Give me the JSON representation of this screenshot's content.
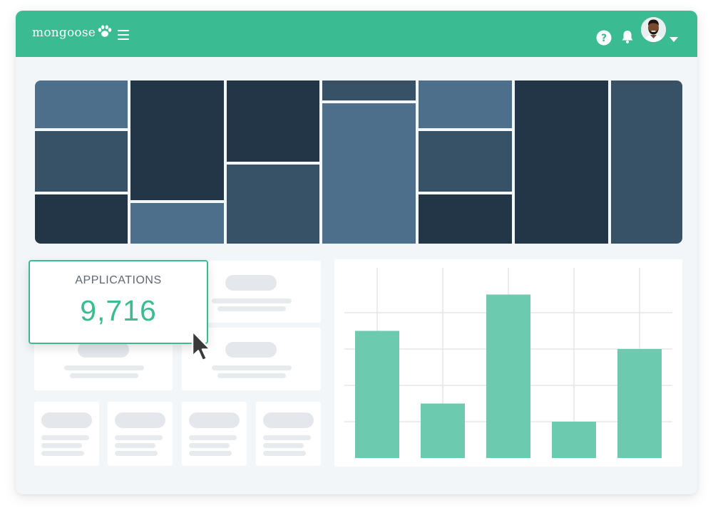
{
  "header": {
    "brand": "mongoose",
    "icons": {
      "logo": "paw-icon",
      "menu": "hamburger-icon",
      "help": "help-circle-icon",
      "notifications": "bell-icon",
      "account_menu": "caret-down-icon"
    },
    "color": "#3bbb91"
  },
  "treemap": {
    "palette": {
      "light": "#4e6f8b",
      "mid": "#375167",
      "dark": "#233648"
    }
  },
  "stat": {
    "label": "APPLICATIONS",
    "value": "9,716"
  },
  "chart_data": {
    "type": "bar",
    "values": [
      70,
      30,
      90,
      20,
      60
    ],
    "ylim": [
      0,
      100
    ],
    "grid": true,
    "bar_color": "#6ccbae"
  }
}
